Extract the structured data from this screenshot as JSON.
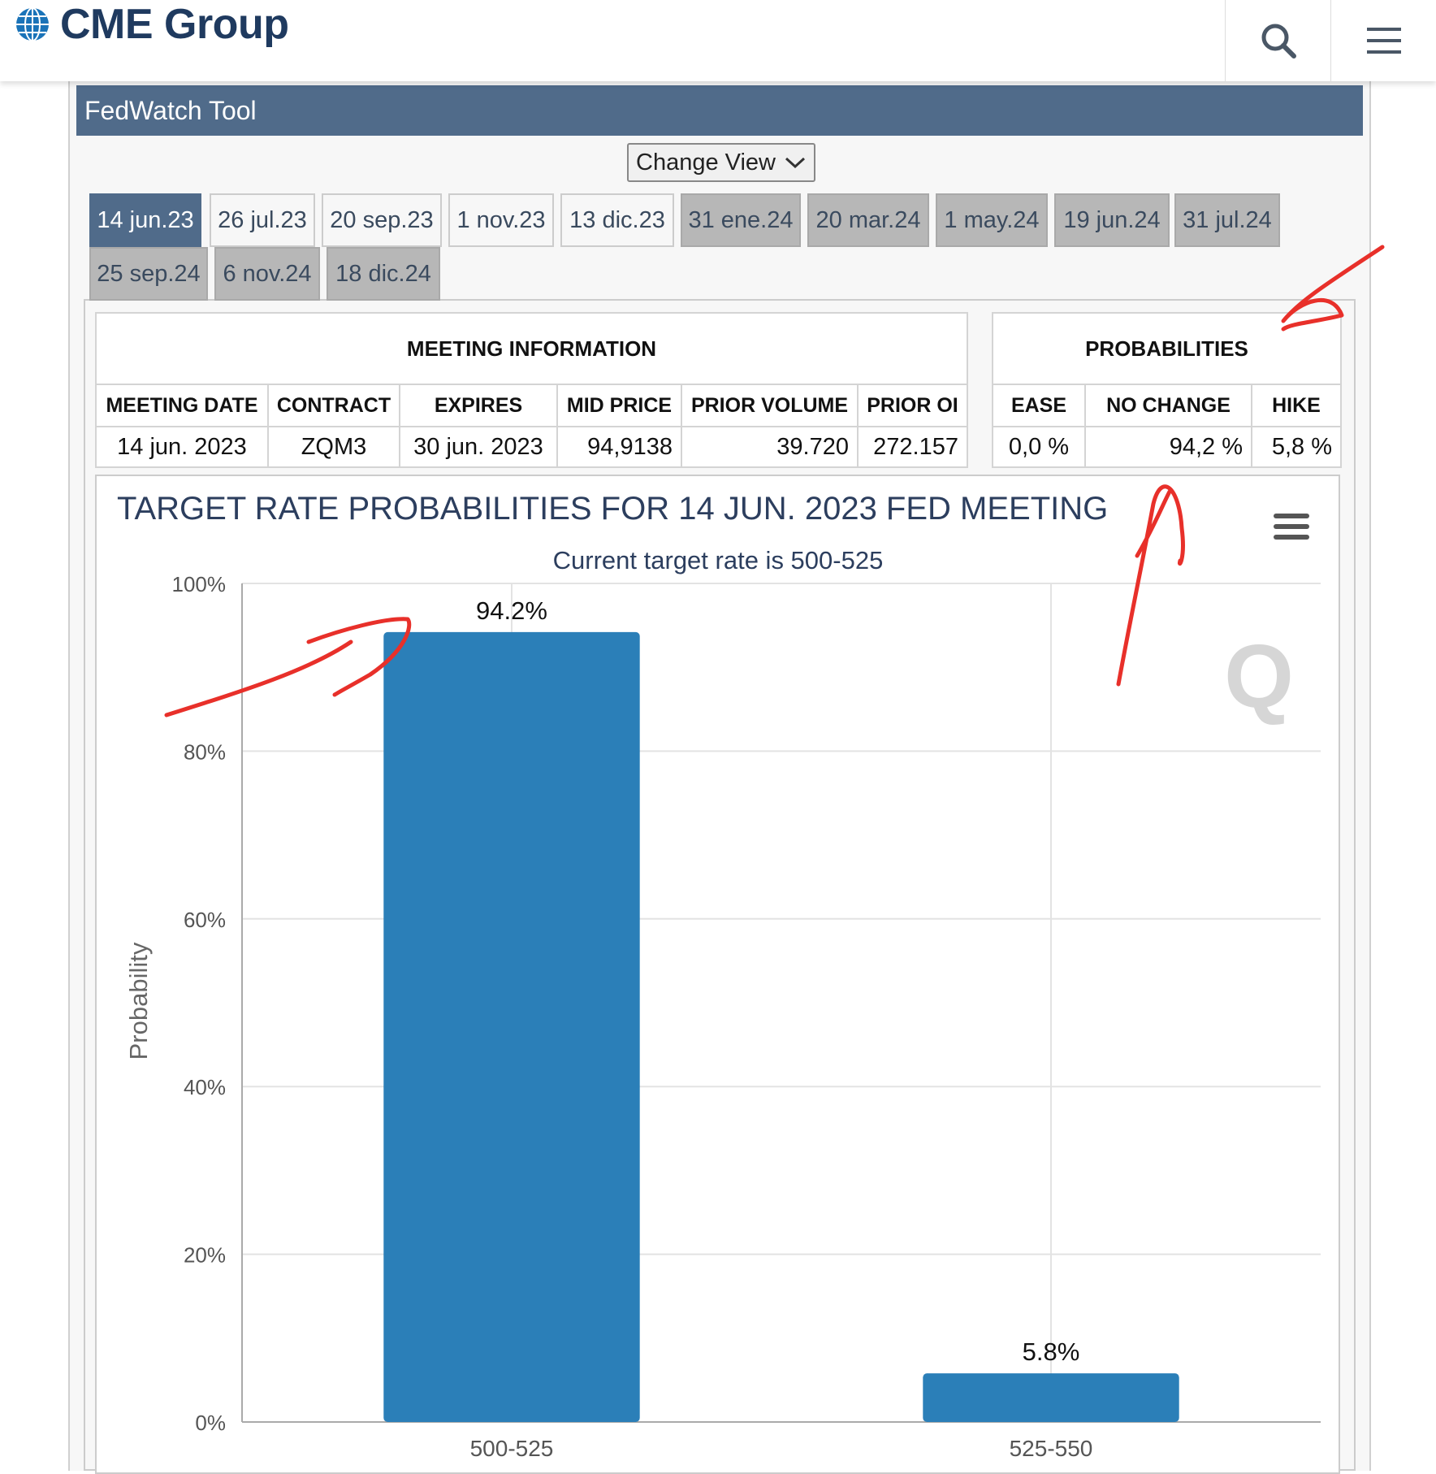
{
  "brand": {
    "name": "CME Group"
  },
  "header": {
    "search_icon": "search-icon",
    "menu_icon": "hamburger-menu-icon"
  },
  "tool": {
    "title": "FedWatch Tool",
    "change_view_label": "Change View"
  },
  "meeting_tabs": [
    {
      "label": "14 jun.23",
      "state": "active"
    },
    {
      "label": "26 jul.23",
      "state": "light"
    },
    {
      "label": "20 sep.23",
      "state": "light"
    },
    {
      "label": "1 nov.23",
      "state": "light"
    },
    {
      "label": "13 dic.23",
      "state": "light"
    },
    {
      "label": "31 ene.24",
      "state": "gray"
    },
    {
      "label": "20 mar.24",
      "state": "gray"
    },
    {
      "label": "1 may.24",
      "state": "gray"
    },
    {
      "label": "19 jun.24",
      "state": "gray"
    },
    {
      "label": "31 jul.24",
      "state": "gray"
    },
    {
      "label": "25 sep.24",
      "state": "gray"
    },
    {
      "label": "6 nov.24",
      "state": "gray"
    },
    {
      "label": "18 dic.24",
      "state": "gray"
    }
  ],
  "meeting_info": {
    "heading": "MEETING INFORMATION",
    "columns": [
      "MEETING DATE",
      "CONTRACT",
      "EXPIRES",
      "MID PRICE",
      "PRIOR VOLUME",
      "PRIOR OI"
    ],
    "row": [
      "14 jun. 2023",
      "ZQM3",
      "30 jun. 2023",
      "94,9138",
      "39.720",
      "272.157"
    ]
  },
  "probabilities": {
    "heading": "PROBABILITIES",
    "columns": [
      "EASE",
      "NO CHANGE",
      "HIKE"
    ],
    "row": [
      "0,0 %",
      "94,2 %",
      "5,8 %"
    ]
  },
  "chart_data": {
    "type": "bar",
    "title": "TARGET RATE PROBABILITIES FOR 14 JUN. 2023 FED MEETING",
    "subtitle": "Current target rate is 500-525",
    "ylabel": "Probability",
    "xlabel": "",
    "categories": [
      "500-525",
      "525-550"
    ],
    "values": [
      94.2,
      5.8
    ],
    "data_labels": [
      "94.2%",
      "5.8%"
    ],
    "ylim": [
      0,
      100
    ],
    "yticks": [
      "0%",
      "20%",
      "40%",
      "60%",
      "80%",
      "100%"
    ],
    "grid": true,
    "bar_color": "#2b7fb8",
    "watermark_letter": "Q"
  },
  "colors": {
    "brand_blue": "#506b8a",
    "bar": "#2b7fb8",
    "annotation": "#e8302a"
  }
}
